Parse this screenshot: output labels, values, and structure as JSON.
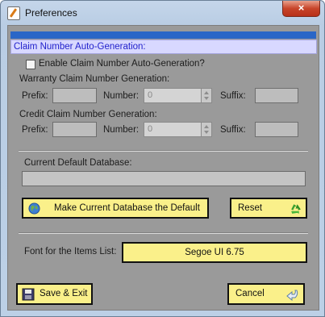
{
  "window": {
    "title": "Preferences",
    "close_glyph": "×"
  },
  "section": {
    "title": "Claim Number Auto-Generation:"
  },
  "enable_checkbox": {
    "label": "Enable Claim Number Auto-Generation?",
    "checked": false
  },
  "warranty": {
    "heading": "Warranty Claim Number Generation:",
    "prefix_label": "Prefix:",
    "number_label": "Number:",
    "suffix_label": "Suffix:",
    "number_value": "0"
  },
  "credit": {
    "heading": "Credit Claim Number Generation:",
    "prefix_label": "Prefix:",
    "number_label": "Number:",
    "suffix_label": "Suffix:",
    "number_value": "0"
  },
  "database": {
    "label": "Current Default Database:",
    "value": "",
    "make_default_label": "Make Current Database the Default",
    "make_default_icon": "globe-icon",
    "reset_label": "Reset",
    "reset_icon": "recycle-icon"
  },
  "font": {
    "label": "Font for the Items List:",
    "value": "Segoe UI 6.75"
  },
  "footer": {
    "save_label": "Save & Exit",
    "save_icon": "floppy-disk-icon",
    "cancel_label": "Cancel",
    "cancel_icon": "cancel-arrow-icon"
  },
  "colors": {
    "button_bg": "#faf08a",
    "section_header_bg": "#d8d8ff",
    "section_header_text": "#2222cc",
    "header_bar": "#2a66c7"
  }
}
